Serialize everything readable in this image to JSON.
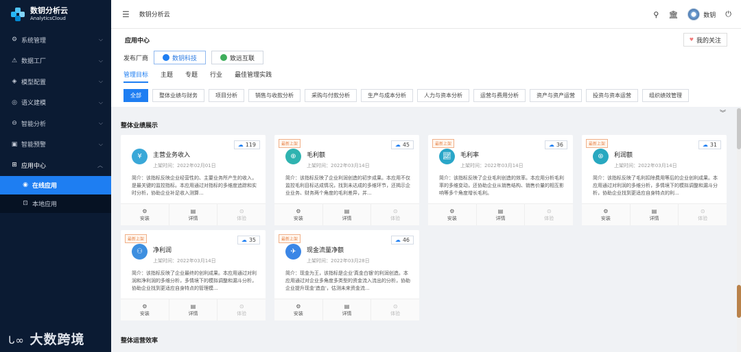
{
  "brand": {
    "name": "数钥分析云",
    "sub": "AnalyticsCloud"
  },
  "sidebar": {
    "items": [
      {
        "label": "系统管理",
        "icon": "gear-icon",
        "glyph": "⚙"
      },
      {
        "label": "数据工厂",
        "icon": "factory-icon",
        "glyph": "⚠"
      },
      {
        "label": "模型配置",
        "icon": "cube-icon",
        "glyph": "◈"
      },
      {
        "label": "语义建模",
        "icon": "target-icon",
        "glyph": "◎"
      },
      {
        "label": "智能分析",
        "icon": "analysis-icon",
        "glyph": "⊖"
      },
      {
        "label": "智能预警",
        "icon": "alert-icon",
        "glyph": "▣"
      },
      {
        "label": "应用中心",
        "icon": "grid-icon",
        "glyph": "⊞"
      }
    ],
    "sub": [
      {
        "label": "在线应用",
        "icon": "cloud-icon",
        "glyph": "◉"
      },
      {
        "label": "本地应用",
        "icon": "box-icon",
        "glyph": "⊡"
      }
    ],
    "watermark": "大数跨境"
  },
  "topbar": {
    "title": "数钥分析云",
    "user": "数钥"
  },
  "header": {
    "title": "应用中心",
    "follow": "我的关注",
    "vendor_label": "发布厂商",
    "vendors": [
      "数钥科技",
      "致远互联"
    ],
    "tabs": [
      "管理目标",
      "主题",
      "专题",
      "行业",
      "最佳管理实践"
    ],
    "filters": [
      "全部",
      "整体业绩与财务",
      "项目分析",
      "销售与收款分析",
      "采购与付款分析",
      "生产与成本分析",
      "人力与资本分析",
      "运营与费用分析",
      "资产与资产运营",
      "投资与资本运营",
      "组织绩效管理"
    ]
  },
  "section1": "整体业绩展示",
  "section2": "整体运营效率",
  "new_badge": "最新上架",
  "actions": [
    "安装",
    "详情",
    "体验"
  ],
  "cards": [
    {
      "name": "主营业务收入",
      "count": "119",
      "date": "上架时间：2022年02月01日",
      "desc": "简介：该指标反映企业经营性的、主要业务所产生的收入，是最关键的监控指标。本应用通过对指标的多维度追踪和实时分析，协助企业补足收入测算...",
      "new": false,
      "color": "#3aa8d8"
    },
    {
      "name": "毛利额",
      "count": "45",
      "date": "上架时间：2022年03月14日",
      "desc": "简介：该指标反映了企业利润创造的初步成果。本应用不仅监控毛利目标达成情况，找到未达成的多维环节，还揭示企业业务、财务两个角度的毛利差异，并...",
      "new": true,
      "color": "#2fb3b0"
    },
    {
      "name": "毛利率",
      "count": "36",
      "date": "上架时间：2022年03月14日",
      "desc": "简介：该指标反映了企业毛利创造的效率。本应用分析毛利率的多维变动，还协助企业从销售结构、销售价量的相互影响等多个角度增长毛利。",
      "new": true,
      "color": "#2aa6c8"
    },
    {
      "name": "利润额",
      "count": "31",
      "date": "上架时间：2022年03月14日",
      "desc": "简介：该指标反映了毛利扣除费用等后的企业创利成果。本应用通过对利润的多维分析，多情境下的模拟调整和漏斗分析，协助企业找到更适应自身特点的利...",
      "new": true,
      "color": "#28a8c0"
    },
    {
      "name": "净利润",
      "count": "35",
      "date": "上架时间：2022年03月14日",
      "desc": "简介：该指标反映了企业最终的创利成果。本应用通过对利润和净利润的多维分析，多情境下的模拟调整和漏斗分析，协助企业找到更适应自身特点的管理模...",
      "new": true,
      "color": "#3d8fe0"
    },
    {
      "name": "现金流量净额",
      "count": "46",
      "date": "上架时间：2022年03月28日",
      "desc": "简介：现金为王，该指标是企业'真金白银'的利润创造。本应用通过对企业多角度多类型的资金流入流出的分析，协助企业提升现金'造血'，估测未来资金流...",
      "new": true,
      "color": "#3b86e6"
    }
  ]
}
